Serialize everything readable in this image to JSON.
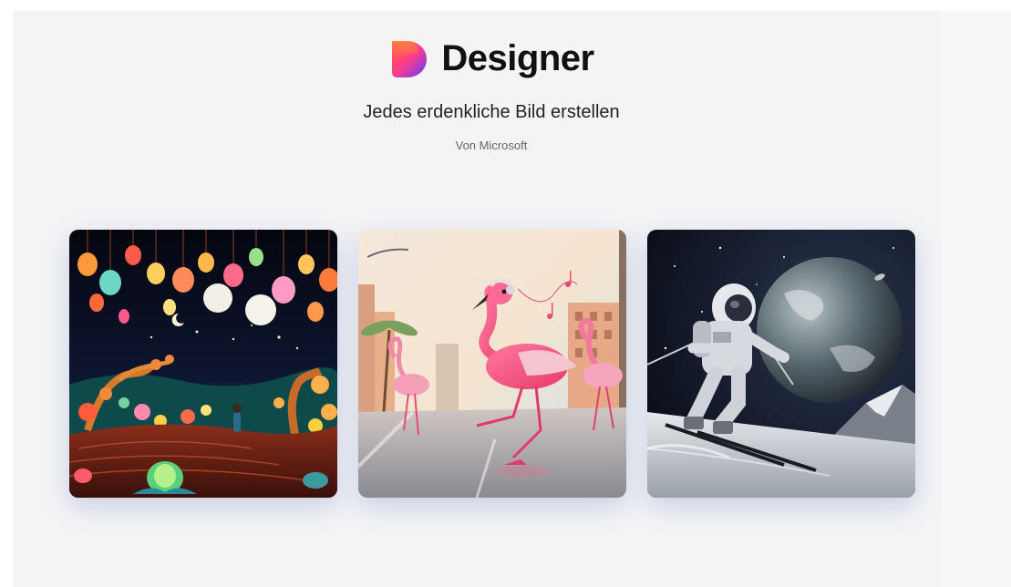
{
  "header": {
    "app_name": "Designer",
    "tagline": "Jedes erdenkliche Bild erstellen",
    "byline": "Von Microsoft",
    "logo_icon": "designer-logo-icon"
  },
  "gallery": {
    "items": [
      {
        "icon": "lantern-night-image"
      },
      {
        "icon": "flamingo-street-image"
      },
      {
        "icon": "astronaut-ski-image"
      }
    ]
  },
  "colors": {
    "background": "#f4f4f5",
    "title": "#111111",
    "text": "#222222",
    "muted": "#666666",
    "logo_orange": "#ff7a45",
    "logo_purple": "#6a4cff"
  }
}
